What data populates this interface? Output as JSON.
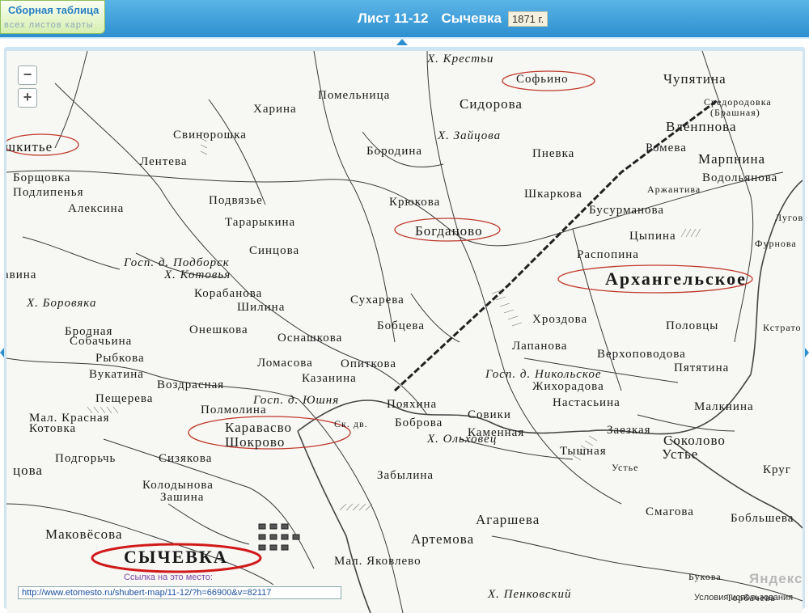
{
  "header": {
    "index_title": "Сборная таблица",
    "index_subtitle": "всех листов карты",
    "sheet": "Лист 11-12",
    "place": "Сычевка",
    "year": "1871 г."
  },
  "map": {
    "link_hint": "Ссылка на это место:",
    "link_url": "http://www.etomesto.ru/shubert-map/11-12/?h=66900&v=82117",
    "provider": "Яндекс",
    "terms": "Условия использования",
    "zoom_out": "−",
    "zoom_in": "+",
    "labels": [
      "Харина",
      "Помельница",
      "Х. Крестьи",
      "Софьино",
      "Сидорова",
      "Чупятина",
      "Средородовка",
      "(Брашная)",
      "Вленпнова",
      "шкитье",
      "Свинорошка",
      "Лентева",
      "Х. Зайцова",
      "Бородина",
      "Пневка",
      "Ромева",
      "Марпнина",
      "Водольянова",
      "Борщовка",
      "Подлипенья",
      "Алексина",
      "Подвязье",
      "Крюкова",
      "Шкаркова",
      "Аржантива",
      "Бусурманова",
      "Луговы",
      "Тарарыкина",
      "Богданово",
      "Цыпина",
      "Фурнова",
      "Синцова",
      "Распопина",
      "Архангельское",
      "Госп. д. Подборск",
      "Х. Котовья",
      "Корабанова",
      "Шилина",
      "Сухарева",
      "Бобцева",
      "Хроздова",
      "Половцы",
      "Кстрато",
      "Х. Боровяка",
      "Бродная",
      "Собачьина",
      "Онешкова",
      "Оснашкова",
      "Лапанова",
      "Верхоповодова",
      "Рыбкова",
      "Вукатина",
      "Ломасова",
      "Опиткова",
      "Госп. д. Никольское",
      "Пятятина",
      "Казанина",
      "Воздрасная",
      "Пещерева",
      "Жихорадова",
      "Пояхина",
      "Совики",
      "Настасьина",
      "Малкнина",
      "Госп. д. Юшня",
      "Полмолина",
      "Мал. Красная",
      "Котовка",
      "Каравасво",
      "Шокрово",
      "Ск. дв.",
      "Боброва",
      "Каменная",
      "Заезкая",
      "Соколово",
      "Устье",
      "Х. Ольховец",
      "Подгорьчь",
      "Сизякова",
      "Тышная",
      "Устье",
      "Круг",
      "цова",
      "Колодынова",
      "Зашина",
      "Забылина",
      "Смагова",
      "Агаршева",
      "Бобльшева",
      "Маковёсова",
      "Артемова",
      "СЫЧЕВКА",
      "Мал. Яковлево",
      "Х. Пенковский",
      "Букова",
      "Торбачева",
      "авина"
    ]
  }
}
